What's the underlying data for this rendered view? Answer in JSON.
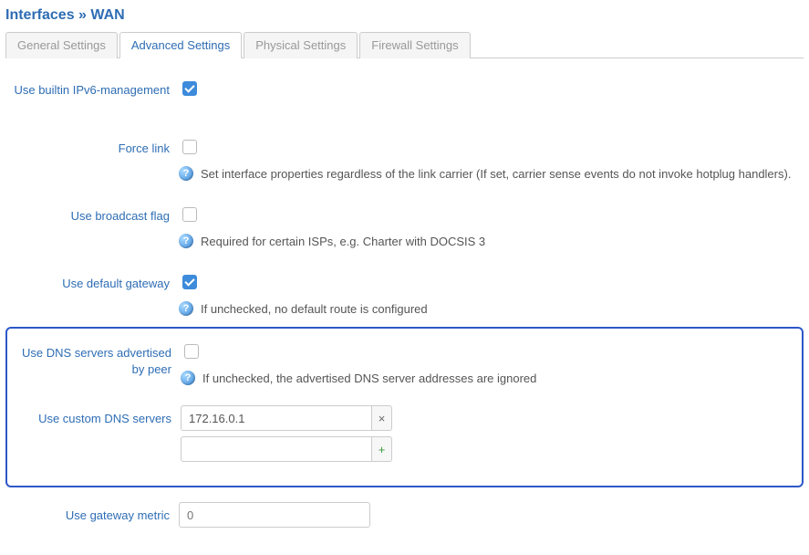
{
  "header": {
    "title": "Interfaces » WAN"
  },
  "tabs": [
    {
      "label": "General Settings"
    },
    {
      "label": "Advanced Settings"
    },
    {
      "label": "Physical Settings"
    },
    {
      "label": "Firewall Settings"
    }
  ],
  "active_tab_index": 1,
  "icons": {
    "help_glyph": "?"
  },
  "options": {
    "ipv6mgmt": {
      "label": "Use builtin IPv6-management",
      "checked": true
    },
    "forcelink": {
      "label": "Force link",
      "checked": false,
      "hint": "Set interface properties regardless of the link carrier (If set, carrier sense events do not invoke hotplug handlers)."
    },
    "broadcast": {
      "label": "Use broadcast flag",
      "checked": false,
      "hint": "Required for certain ISPs, e.g. Charter with DOCSIS 3"
    },
    "defaultgw": {
      "label": "Use default gateway",
      "checked": true,
      "hint": "If unchecked, no default route is configured"
    },
    "peerdns": {
      "label": "Use DNS servers advertised by peer",
      "checked": false,
      "hint": "If unchecked, the advertised DNS server addresses are ignored"
    },
    "customdns": {
      "label": "Use custom DNS servers",
      "entries": [
        {
          "value": "172.16.0.1"
        }
      ],
      "new_placeholder": "",
      "remove_glyph": "×",
      "add_glyph": "+"
    },
    "gwmetric": {
      "label": "Use gateway metric",
      "value": "",
      "placeholder": "0"
    }
  }
}
